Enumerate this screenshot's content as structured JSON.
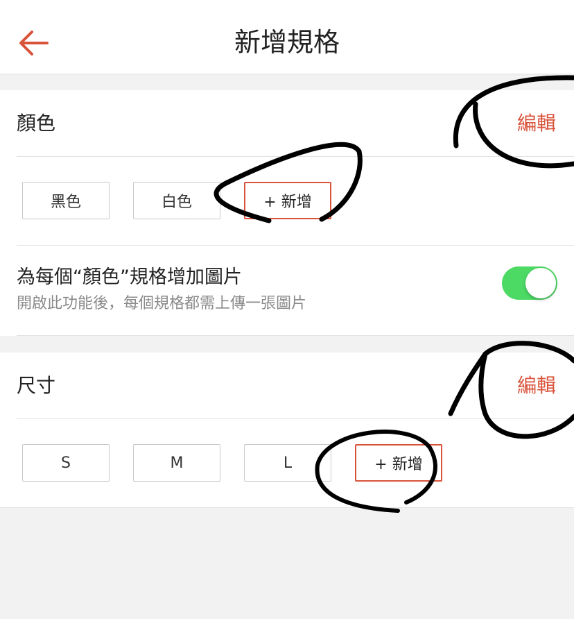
{
  "header": {
    "title": "新增規格",
    "back_icon": "arrow-left-icon",
    "accent_color": "#d9533b"
  },
  "color_section": {
    "title": "顏色",
    "edit_label": "編輯",
    "chips": [
      "黑色",
      "白色"
    ],
    "add_label": "+ 新增",
    "option": {
      "title": "為每個“顏色”規格增加圖片",
      "subtitle": "開啟此功能後，每個規格都需上傳一張圖片",
      "toggle_on": true,
      "toggle_color": "#4cd964"
    }
  },
  "size_section": {
    "title": "尺寸",
    "edit_label": "編輯",
    "chips": [
      "S",
      "M",
      "L"
    ],
    "add_label": "+ 新增"
  }
}
